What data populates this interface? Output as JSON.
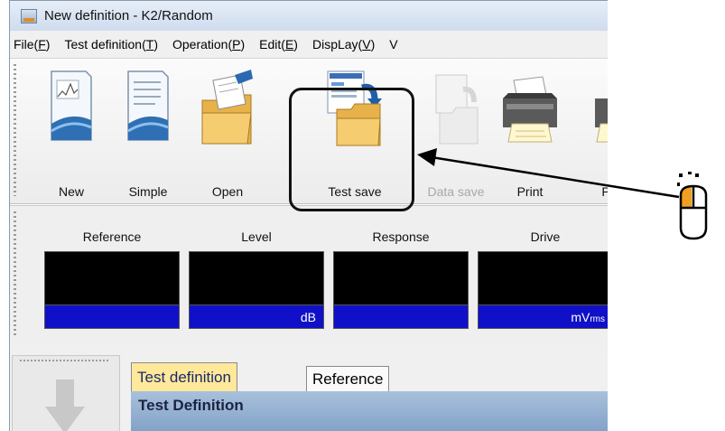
{
  "window": {
    "title": "New definition - K2/Random"
  },
  "menu": [
    {
      "before": "File(",
      "key": "F",
      "after": ")"
    },
    {
      "before": "Test definition(",
      "key": "T",
      "after": ")"
    },
    {
      "before": "Operation(",
      "key": "P",
      "after": ")"
    },
    {
      "before": "Edit(",
      "key": "E",
      "after": ")"
    },
    {
      "before": "DispLay(",
      "key": "V",
      "after": ")"
    },
    {
      "before": "V",
      "key": "",
      "after": ""
    }
  ],
  "toolbar": {
    "new_label": "New",
    "simple_label": "Simple",
    "open_label": "Open",
    "test_save_label": "Test save",
    "data_save_label": "Data save",
    "print_label": "Print",
    "next_label": "P"
  },
  "monitor": {
    "reference": {
      "caption": "Reference",
      "unit": ""
    },
    "level": {
      "caption": "Level",
      "unit": "dB"
    },
    "response": {
      "caption": "Response",
      "unit": ""
    },
    "drive": {
      "caption": "Drive",
      "unit": "mV",
      "unit_sub": "rms"
    }
  },
  "tabs": {
    "active": "Test definition",
    "inactive": "Reference"
  },
  "section": {
    "header": "Test Definition"
  },
  "icons": [
    "new-doc-icon",
    "simple-doc-icon",
    "open-folder-icon",
    "test-save-icon",
    "data-save-icon",
    "printer-icon",
    "mouse-left-click-icon",
    "arrow-pointer"
  ],
  "colors": {
    "monitor_value_bg": "#1010c8",
    "active_tab": "#ffe89a",
    "mouse_button": "#f0a020"
  }
}
